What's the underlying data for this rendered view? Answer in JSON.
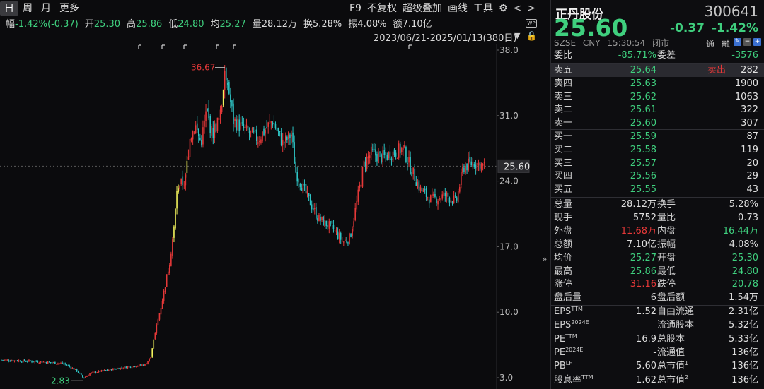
{
  "tabs": [
    {
      "label": "日",
      "active": true
    },
    {
      "label": "周",
      "active": false
    },
    {
      "label": "月",
      "active": false
    },
    {
      "label": "更多",
      "active": false
    }
  ],
  "toolbar": {
    "f9": "F9",
    "no_adjust": "不复权",
    "overlay": "超级叠加",
    "draw": "画线",
    "tools": "工具",
    "gear": "gear-icon",
    "prev": "chevron-left-icon",
    "next": "chevron-right-icon"
  },
  "infobar": {
    "fu_label": "幅",
    "fu_value": "-1.42%(-0.37)",
    "open_label": "开",
    "open_value": "25.30",
    "high_label": "高",
    "high_value": "25.86",
    "low_label": "低",
    "low_value": "24.80",
    "avg_label": "均",
    "avg_value": "25.27",
    "vol_label": "量",
    "vol_value": "28.12万",
    "turnover_label": "换",
    "turnover_value": "5.28%",
    "amp_label": "振",
    "amp_value": "4.08%",
    "amount_label": "额",
    "amount_value": "7.10亿"
  },
  "range": {
    "text": "2023/06/21-2025/01/13(380日)",
    "badge": "WP"
  },
  "chart_data": {
    "type": "candlestick",
    "y_axis_ticks": [
      "38.0",
      "31.0",
      "24.0",
      "17.0",
      "10.0",
      "3.0"
    ],
    "ylim": [
      3.0,
      38.0
    ],
    "current_price_label": "25.60",
    "max_annotation": "36.67",
    "min_annotation": "2.83",
    "colors": {
      "up": "#e53838",
      "down": "#2ec4c4",
      "limit_up": "#f2f25c"
    }
  },
  "stock": {
    "name": "正丹股份",
    "code": "300641",
    "price": "25.60",
    "change": "-0.37",
    "change_pct": "-1.42%",
    "exchange": "SZSE",
    "currency": "CNY",
    "time": "15:30:54",
    "status": "闭市",
    "tong": "通",
    "rong": "融"
  },
  "weibi": {
    "label": "委比",
    "value": "-85.71%",
    "label2": "委差",
    "value2": "-3576"
  },
  "asks": [
    {
      "label": "卖五",
      "price": "25.64",
      "vol": "282",
      "tag": "卖出"
    },
    {
      "label": "卖四",
      "price": "25.63",
      "vol": "1900"
    },
    {
      "label": "卖三",
      "price": "25.62",
      "vol": "1063"
    },
    {
      "label": "卖二",
      "price": "25.61",
      "vol": "322"
    },
    {
      "label": "卖一",
      "price": "25.60",
      "vol": "307"
    }
  ],
  "bids": [
    {
      "label": "买一",
      "price": "25.59",
      "vol": "87"
    },
    {
      "label": "买二",
      "price": "25.58",
      "vol": "119"
    },
    {
      "label": "买三",
      "price": "25.57",
      "vol": "20"
    },
    {
      "label": "买四",
      "price": "25.56",
      "vol": "29"
    },
    {
      "label": "买五",
      "price": "25.55",
      "vol": "43"
    }
  ],
  "stats": [
    {
      "l1": "总量",
      "v1": "28.12万",
      "c1": "w",
      "l2": "换手",
      "v2": "5.28%",
      "c2": "w"
    },
    {
      "l1": "现手",
      "v1": "5752",
      "c1": "w",
      "l2": "量比",
      "v2": "0.73",
      "c2": "w"
    },
    {
      "l1": "外盘",
      "v1": "11.68万",
      "c1": "r",
      "l2": "内盘",
      "v2": "16.44万",
      "c2": "g"
    },
    {
      "l1": "总额",
      "v1": "7.10亿",
      "c1": "w",
      "l2": "振幅",
      "v2": "4.08%",
      "c2": "w"
    },
    {
      "l1": "均价",
      "v1": "25.27",
      "c1": "g",
      "l2": "开盘",
      "v2": "25.30",
      "c2": "g"
    },
    {
      "l1": "最高",
      "v1": "25.86",
      "c1": "g",
      "l2": "最低",
      "v2": "24.80",
      "c2": "g"
    },
    {
      "l1": "涨停",
      "v1": "31.16",
      "c1": "r",
      "l2": "跌停",
      "v2": "20.78",
      "c2": "g"
    },
    {
      "l1": "盘后量",
      "v1": "6",
      "c1": "w",
      "l2": "盘后额",
      "v2": "1.54万",
      "c2": "w"
    }
  ],
  "fundamentals": [
    {
      "l1": "EPS",
      "s1": "TTM",
      "v1": "1.52",
      "l2": "自由流通",
      "s2": "",
      "v2": "2.31亿"
    },
    {
      "l1": "EPS",
      "s1": "2024E",
      "v1": "",
      "l2": "流通股本",
      "s2": "",
      "v2": "5.32亿"
    },
    {
      "l1": "PE",
      "s1": "TTM",
      "v1": "16.9",
      "l2": "总股本",
      "s2": "",
      "v2": "5.33亿"
    },
    {
      "l1": "PE",
      "s1": "2024E",
      "v1": "-",
      "l2": "流通值",
      "s2": "",
      "v2": "136亿"
    },
    {
      "l1": "PB",
      "s1": "LF",
      "v1": "5.60",
      "l2": "总市值",
      "s2": "1",
      "v2": "136亿"
    },
    {
      "l1": "股息率",
      "s1": "TTM",
      "v1": "1.62",
      "l2": "总市值",
      "s2": "2",
      "v2": "136亿"
    }
  ]
}
